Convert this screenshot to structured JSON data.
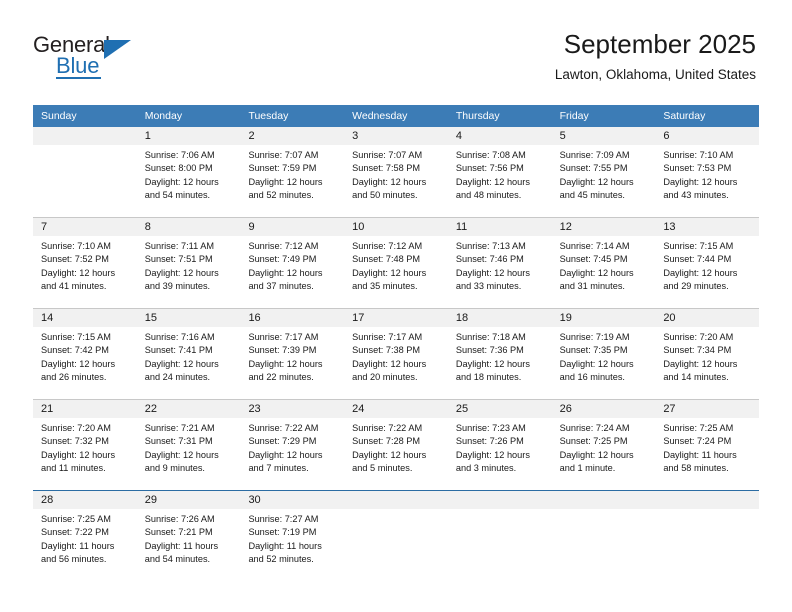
{
  "logo": {
    "line1": "General",
    "line2": "Blue",
    "accent_color": "#1f6fb2",
    "triangle_icon": "blue-triangle-icon"
  },
  "header": {
    "title": "September 2025",
    "subtitle": "Lawton, Oklahoma, United States"
  },
  "calendar": {
    "header_bg": "#3c7cb6",
    "header_text_color": "#ffffff",
    "day_band_bg": "#f1f1f1",
    "weekdays": [
      "Sunday",
      "Monday",
      "Tuesday",
      "Wednesday",
      "Thursday",
      "Friday",
      "Saturday"
    ],
    "weeks": [
      [
        {
          "day": "",
          "sunrise": "",
          "sunset": "",
          "daylight1": "",
          "daylight2": "",
          "empty": true
        },
        {
          "day": "1",
          "sunrise": "Sunrise: 7:06 AM",
          "sunset": "Sunset: 8:00 PM",
          "daylight1": "Daylight: 12 hours",
          "daylight2": "and 54 minutes."
        },
        {
          "day": "2",
          "sunrise": "Sunrise: 7:07 AM",
          "sunset": "Sunset: 7:59 PM",
          "daylight1": "Daylight: 12 hours",
          "daylight2": "and 52 minutes."
        },
        {
          "day": "3",
          "sunrise": "Sunrise: 7:07 AM",
          "sunset": "Sunset: 7:58 PM",
          "daylight1": "Daylight: 12 hours",
          "daylight2": "and 50 minutes."
        },
        {
          "day": "4",
          "sunrise": "Sunrise: 7:08 AM",
          "sunset": "Sunset: 7:56 PM",
          "daylight1": "Daylight: 12 hours",
          "daylight2": "and 48 minutes."
        },
        {
          "day": "5",
          "sunrise": "Sunrise: 7:09 AM",
          "sunset": "Sunset: 7:55 PM",
          "daylight1": "Daylight: 12 hours",
          "daylight2": "and 45 minutes."
        },
        {
          "day": "6",
          "sunrise": "Sunrise: 7:10 AM",
          "sunset": "Sunset: 7:53 PM",
          "daylight1": "Daylight: 12 hours",
          "daylight2": "and 43 minutes."
        }
      ],
      [
        {
          "day": "7",
          "sunrise": "Sunrise: 7:10 AM",
          "sunset": "Sunset: 7:52 PM",
          "daylight1": "Daylight: 12 hours",
          "daylight2": "and 41 minutes."
        },
        {
          "day": "8",
          "sunrise": "Sunrise: 7:11 AM",
          "sunset": "Sunset: 7:51 PM",
          "daylight1": "Daylight: 12 hours",
          "daylight2": "and 39 minutes."
        },
        {
          "day": "9",
          "sunrise": "Sunrise: 7:12 AM",
          "sunset": "Sunset: 7:49 PM",
          "daylight1": "Daylight: 12 hours",
          "daylight2": "and 37 minutes."
        },
        {
          "day": "10",
          "sunrise": "Sunrise: 7:12 AM",
          "sunset": "Sunset: 7:48 PM",
          "daylight1": "Daylight: 12 hours",
          "daylight2": "and 35 minutes."
        },
        {
          "day": "11",
          "sunrise": "Sunrise: 7:13 AM",
          "sunset": "Sunset: 7:46 PM",
          "daylight1": "Daylight: 12 hours",
          "daylight2": "and 33 minutes."
        },
        {
          "day": "12",
          "sunrise": "Sunrise: 7:14 AM",
          "sunset": "Sunset: 7:45 PM",
          "daylight1": "Daylight: 12 hours",
          "daylight2": "and 31 minutes."
        },
        {
          "day": "13",
          "sunrise": "Sunrise: 7:15 AM",
          "sunset": "Sunset: 7:44 PM",
          "daylight1": "Daylight: 12 hours",
          "daylight2": "and 29 minutes."
        }
      ],
      [
        {
          "day": "14",
          "sunrise": "Sunrise: 7:15 AM",
          "sunset": "Sunset: 7:42 PM",
          "daylight1": "Daylight: 12 hours",
          "daylight2": "and 26 minutes."
        },
        {
          "day": "15",
          "sunrise": "Sunrise: 7:16 AM",
          "sunset": "Sunset: 7:41 PM",
          "daylight1": "Daylight: 12 hours",
          "daylight2": "and 24 minutes."
        },
        {
          "day": "16",
          "sunrise": "Sunrise: 7:17 AM",
          "sunset": "Sunset: 7:39 PM",
          "daylight1": "Daylight: 12 hours",
          "daylight2": "and 22 minutes."
        },
        {
          "day": "17",
          "sunrise": "Sunrise: 7:17 AM",
          "sunset": "Sunset: 7:38 PM",
          "daylight1": "Daylight: 12 hours",
          "daylight2": "and 20 minutes."
        },
        {
          "day": "18",
          "sunrise": "Sunrise: 7:18 AM",
          "sunset": "Sunset: 7:36 PM",
          "daylight1": "Daylight: 12 hours",
          "daylight2": "and 18 minutes."
        },
        {
          "day": "19",
          "sunrise": "Sunrise: 7:19 AM",
          "sunset": "Sunset: 7:35 PM",
          "daylight1": "Daylight: 12 hours",
          "daylight2": "and 16 minutes."
        },
        {
          "day": "20",
          "sunrise": "Sunrise: 7:20 AM",
          "sunset": "Sunset: 7:34 PM",
          "daylight1": "Daylight: 12 hours",
          "daylight2": "and 14 minutes."
        }
      ],
      [
        {
          "day": "21",
          "sunrise": "Sunrise: 7:20 AM",
          "sunset": "Sunset: 7:32 PM",
          "daylight1": "Daylight: 12 hours",
          "daylight2": "and 11 minutes."
        },
        {
          "day": "22",
          "sunrise": "Sunrise: 7:21 AM",
          "sunset": "Sunset: 7:31 PM",
          "daylight1": "Daylight: 12 hours",
          "daylight2": "and 9 minutes."
        },
        {
          "day": "23",
          "sunrise": "Sunrise: 7:22 AM",
          "sunset": "Sunset: 7:29 PM",
          "daylight1": "Daylight: 12 hours",
          "daylight2": "and 7 minutes."
        },
        {
          "day": "24",
          "sunrise": "Sunrise: 7:22 AM",
          "sunset": "Sunset: 7:28 PM",
          "daylight1": "Daylight: 12 hours",
          "daylight2": "and 5 minutes."
        },
        {
          "day": "25",
          "sunrise": "Sunrise: 7:23 AM",
          "sunset": "Sunset: 7:26 PM",
          "daylight1": "Daylight: 12 hours",
          "daylight2": "and 3 minutes."
        },
        {
          "day": "26",
          "sunrise": "Sunrise: 7:24 AM",
          "sunset": "Sunset: 7:25 PM",
          "daylight1": "Daylight: 12 hours",
          "daylight2": "and 1 minute."
        },
        {
          "day": "27",
          "sunrise": "Sunrise: 7:25 AM",
          "sunset": "Sunset: 7:24 PM",
          "daylight1": "Daylight: 11 hours",
          "daylight2": "and 58 minutes."
        }
      ],
      [
        {
          "day": "28",
          "sunrise": "Sunrise: 7:25 AM",
          "sunset": "Sunset: 7:22 PM",
          "daylight1": "Daylight: 11 hours",
          "daylight2": "and 56 minutes."
        },
        {
          "day": "29",
          "sunrise": "Sunrise: 7:26 AM",
          "sunset": "Sunset: 7:21 PM",
          "daylight1": "Daylight: 11 hours",
          "daylight2": "and 54 minutes."
        },
        {
          "day": "30",
          "sunrise": "Sunrise: 7:27 AM",
          "sunset": "Sunset: 7:19 PM",
          "daylight1": "Daylight: 11 hours",
          "daylight2": "and 52 minutes."
        },
        {
          "day": "",
          "sunrise": "",
          "sunset": "",
          "daylight1": "",
          "daylight2": "",
          "empty": true
        },
        {
          "day": "",
          "sunrise": "",
          "sunset": "",
          "daylight1": "",
          "daylight2": "",
          "empty": true
        },
        {
          "day": "",
          "sunrise": "",
          "sunset": "",
          "daylight1": "",
          "daylight2": "",
          "empty": true
        },
        {
          "day": "",
          "sunrise": "",
          "sunset": "",
          "daylight1": "",
          "daylight2": "",
          "empty": true
        }
      ]
    ]
  }
}
